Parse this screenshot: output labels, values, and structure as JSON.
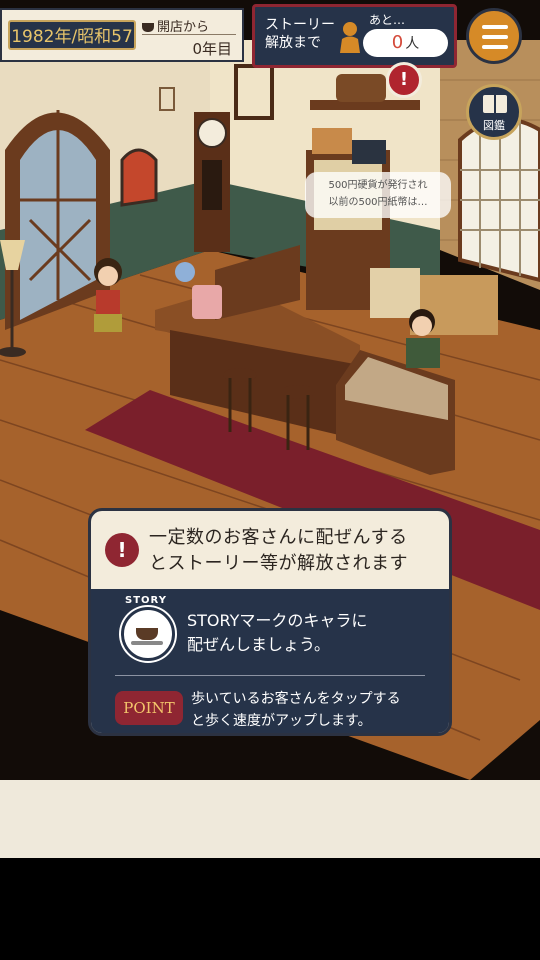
{
  "hud": {
    "era_label": "1982年/昭和57",
    "since_opening_label": "開店から",
    "years_value": "0年目",
    "story_unlock_label_line1": "ストーリー",
    "story_unlock_label_line2": "解放まで",
    "remaining_label": "あと…",
    "remaining_count": "0",
    "remaining_unit": "人",
    "alert_mark": "!",
    "menu_icon": "hamburger-menu-icon",
    "guide_label": "図鑑"
  },
  "news_bubble": {
    "line1": "500円硬貨が発行され",
    "line2": "以前の500円紙幣は…"
  },
  "tutorial": {
    "head_icon": "!",
    "head_line1": "一定数のお客さんに配ぜんする",
    "head_line2": "とストーリー等が解放されます",
    "story_badge_label": "STORY",
    "story_line1": "STORYマークのキャラに",
    "story_line2": "配ぜんしましょう。",
    "point_badge": "POINT",
    "point_line1": "歩いているお客さんをタップする",
    "point_line2": "と歩く速度がアップします。"
  },
  "colors": {
    "navy": "#263349",
    "crimson": "#8f2632",
    "cream": "#f3ecdc",
    "orange": "#d68a27",
    "gold": "#c7a45c"
  }
}
